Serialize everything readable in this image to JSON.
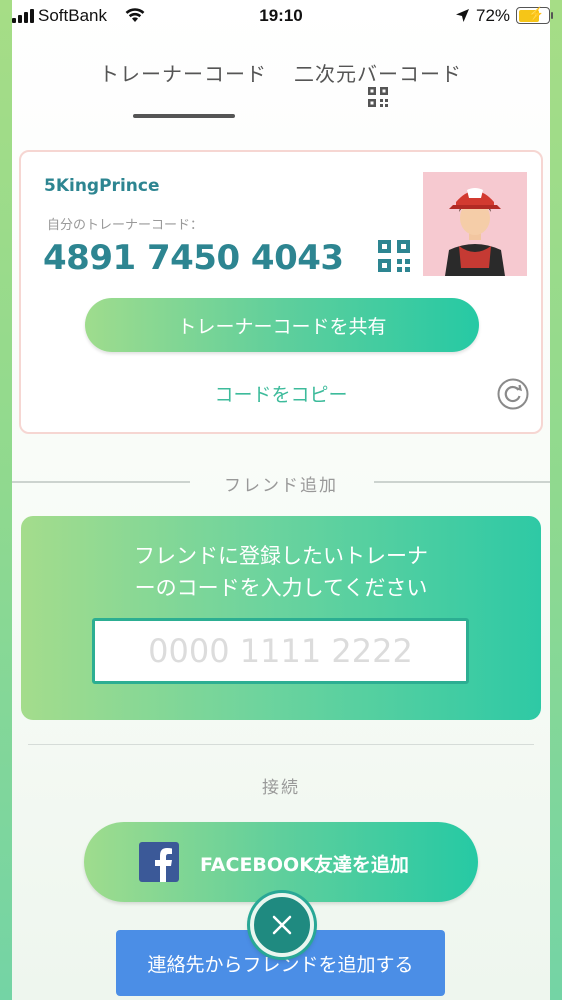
{
  "status_bar": {
    "carrier": "SoftBank",
    "time": "19:10",
    "battery": "72%"
  },
  "tabs": [
    {
      "label": "トレーナーコード",
      "active": true
    },
    {
      "label": "二次元バーコード",
      "active": false
    }
  ],
  "trainer_card": {
    "name": "5KingPrince",
    "code_label": "自分のトレーナーコード：",
    "code": "4891 7450 4043",
    "share_label": "トレーナーコードを共有",
    "copy_label": "コードをコピー"
  },
  "add_friend": {
    "section_label": "フレンド追加",
    "prompt_line1": "フレンドに登録したいトレーナ",
    "prompt_line2": "ーのコードを入力してください",
    "input_placeholder": "0000 1111 2222",
    "input_value": ""
  },
  "connect": {
    "section_label": "接続",
    "facebook_label": "FACEBOOK友達を追加",
    "contacts_label": "連絡先からフレンドを追加する"
  },
  "colors": {
    "accent_teal": "#2d8591",
    "gradient_start": "#a4dc8c",
    "gradient_end": "#26c9a4",
    "contacts_blue": "#4b8ee6",
    "facebook_blue": "#3b5998"
  },
  "icons": [
    "signal-icon",
    "wifi-icon",
    "location-arrow-icon",
    "battery-icon",
    "qr-code-icon",
    "refresh-icon",
    "facebook-icon",
    "close-icon"
  ]
}
